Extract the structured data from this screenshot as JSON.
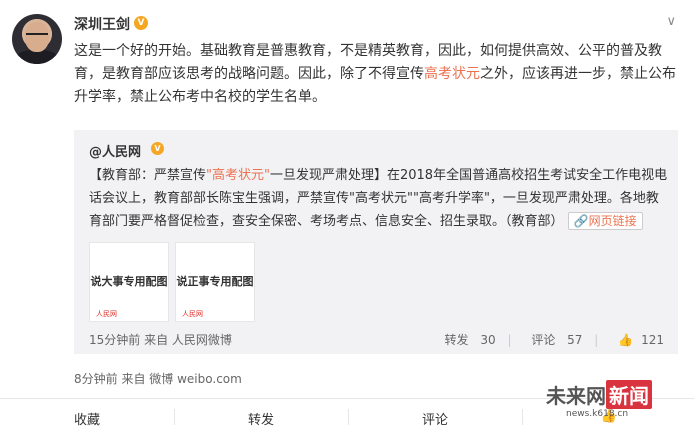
{
  "post": {
    "username": "深圳王剑",
    "verified": "V",
    "menu_icon": "chevron-down-icon",
    "text_before": "这是一个好的开始。基础教育是普惠教育，不是精英教育，因此，如何提供高效、公平的普及教育，是教育部应该思考的战略问题。因此，除了不得宣传",
    "text_link": "高考状元",
    "text_after": "之外，应该再进一步，禁止公布升学率，禁止公布考中名校的学生名单。",
    "time": "8分钟前",
    "source": "来自 微博 weibo.com"
  },
  "repost": {
    "author": "@人民网",
    "verified": "V",
    "text_a": "【教育部：严禁宣传",
    "text_link": "\"高考状元\"",
    "text_b": "一旦发现严肃处理】在2018年全国普通高校招生考试安全工作电视电话会议上，教育部部长陈宝生强调，严禁宣传\"高考状元\"\"高考升学率\"，一旦发现严肃处理。各地教育部门要严格督促检查，查安全保密、考场考点、信息安全、招生录取。（教育部）",
    "weblink_icon": "link-icon",
    "weblink_label": "网页链接",
    "images": [
      {
        "label": "说大事专用配图",
        "mark": "人民网"
      },
      {
        "label": "说正事专用配图",
        "mark": "人民网"
      }
    ],
    "time": "15分钟前",
    "source": "来自 人民网微博",
    "repost_label": "转发",
    "repost_count": "30",
    "comment_label": "评论",
    "comment_count": "57",
    "like_icon": "thumbs-up-icon",
    "like_count": "121"
  },
  "toolbar": {
    "favorite": "收藏",
    "forward": "转发",
    "comment": "评论",
    "like_icon": "thumbs-up-icon"
  },
  "watermark": {
    "brand_a": "未来网",
    "brand_b": "新闻",
    "url": "news.k618.cn"
  },
  "colors": {
    "link": "#eb7350",
    "verified": "#f5a623",
    "repost_bg": "#f2f2f5"
  }
}
